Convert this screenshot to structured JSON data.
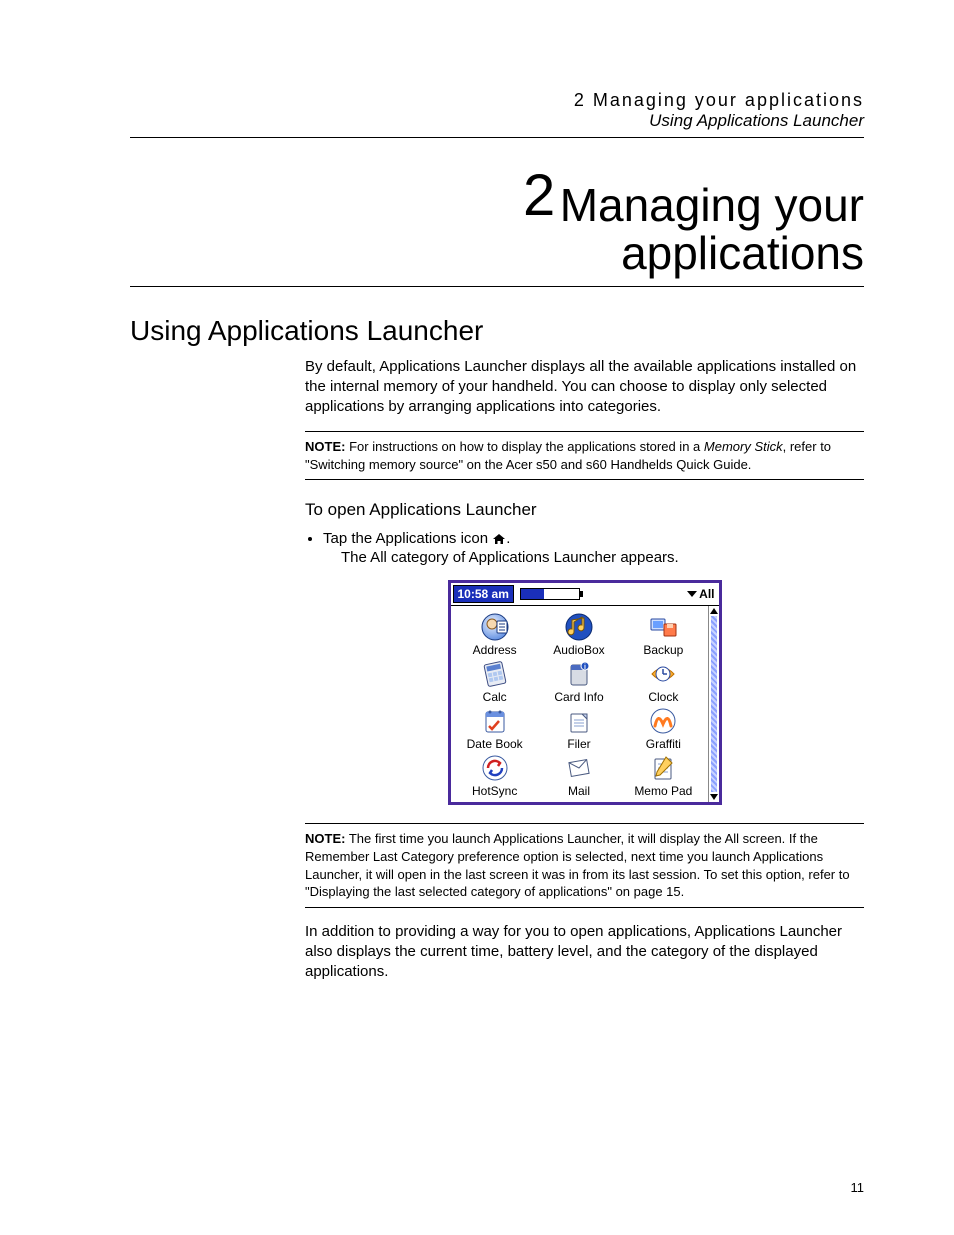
{
  "header": {
    "line1": "2 Managing your applications",
    "line2": "Using Applications Launcher"
  },
  "chapter": {
    "number": "2",
    "title": "Managing your applications"
  },
  "section": {
    "h1": "Using Applications Launcher",
    "intro": "By default, Applications Launcher displays all the available applications installed on the internal memory of your handheld. You can choose to display only selected applications by arranging applications into categories.",
    "note1": {
      "label": "NOTE:",
      "before_ms": "For instructions on how to display the applications stored in a ",
      "ms": "Memory Stick",
      "after_ms": ", refer to \"Switching memory source\" on the Acer s50 and s60 Handhelds Quick Guide."
    },
    "h2": "To open Applications Launcher",
    "bullet": "Tap the Applications icon ",
    "bullet_tail": ".",
    "bullet_sub": "The All category of Applications Launcher appears.",
    "note2": {
      "label": "NOTE:",
      "text": "The first time you launch Applications Launcher, it will display the All screen. If the Remember Last Category preference option is selected, next time you launch Applications Launcher, it will open in the last screen it was in from its last session. To set this option, refer to \"Displaying the last selected category of applications\" on page 15."
    },
    "closing": "In addition to providing a way for you to open applications, Applications Launcher also displays the current time, battery level, and the category of the displayed applications."
  },
  "palm": {
    "time": "10:58 am",
    "category": "All",
    "apps": [
      "Address",
      "AudioBox",
      "Backup",
      "Calc",
      "Card Info",
      "Clock",
      "Date Book",
      "Filer",
      "Graffiti",
      "HotSync",
      "Mail",
      "Memo Pad"
    ]
  },
  "page_number": "11"
}
